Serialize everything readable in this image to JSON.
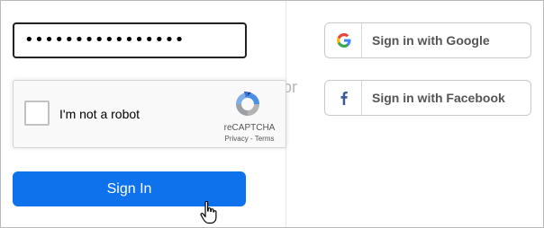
{
  "password": {
    "masked_value": "••••••••••••••••"
  },
  "divider_text": "or",
  "recaptcha": {
    "checkbox_label": "I'm not a robot",
    "brand": "reCAPTCHA",
    "links": "Privacy - Terms"
  },
  "signin": {
    "label": "Sign In"
  },
  "social": {
    "google_label": "Sign in with Google",
    "facebook_label": "Sign in with Facebook"
  },
  "colors": {
    "primary_button": "#0e72ed",
    "facebook": "#3b5998"
  },
  "icons": [
    "recaptcha-logo-icon",
    "google-icon",
    "facebook-icon",
    "hand-cursor-icon"
  ]
}
